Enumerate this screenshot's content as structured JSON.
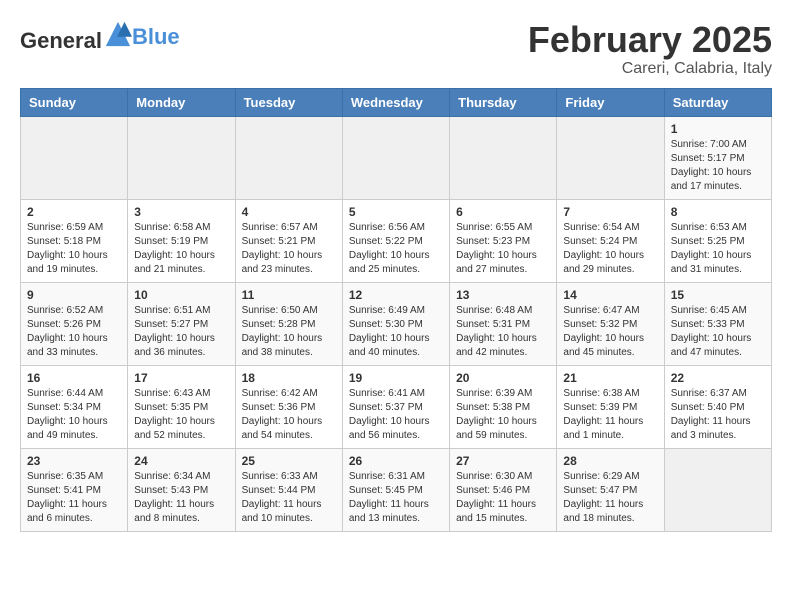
{
  "header": {
    "logo_general": "General",
    "logo_blue": "Blue",
    "title": "February 2025",
    "subtitle": "Careri, Calabria, Italy"
  },
  "days_of_week": [
    "Sunday",
    "Monday",
    "Tuesday",
    "Wednesday",
    "Thursday",
    "Friday",
    "Saturday"
  ],
  "weeks": [
    [
      {
        "day": "",
        "info": ""
      },
      {
        "day": "",
        "info": ""
      },
      {
        "day": "",
        "info": ""
      },
      {
        "day": "",
        "info": ""
      },
      {
        "day": "",
        "info": ""
      },
      {
        "day": "",
        "info": ""
      },
      {
        "day": "1",
        "info": "Sunrise: 7:00 AM\nSunset: 5:17 PM\nDaylight: 10 hours and 17 minutes."
      }
    ],
    [
      {
        "day": "2",
        "info": "Sunrise: 6:59 AM\nSunset: 5:18 PM\nDaylight: 10 hours and 19 minutes."
      },
      {
        "day": "3",
        "info": "Sunrise: 6:58 AM\nSunset: 5:19 PM\nDaylight: 10 hours and 21 minutes."
      },
      {
        "day": "4",
        "info": "Sunrise: 6:57 AM\nSunset: 5:21 PM\nDaylight: 10 hours and 23 minutes."
      },
      {
        "day": "5",
        "info": "Sunrise: 6:56 AM\nSunset: 5:22 PM\nDaylight: 10 hours and 25 minutes."
      },
      {
        "day": "6",
        "info": "Sunrise: 6:55 AM\nSunset: 5:23 PM\nDaylight: 10 hours and 27 minutes."
      },
      {
        "day": "7",
        "info": "Sunrise: 6:54 AM\nSunset: 5:24 PM\nDaylight: 10 hours and 29 minutes."
      },
      {
        "day": "8",
        "info": "Sunrise: 6:53 AM\nSunset: 5:25 PM\nDaylight: 10 hours and 31 minutes."
      }
    ],
    [
      {
        "day": "9",
        "info": "Sunrise: 6:52 AM\nSunset: 5:26 PM\nDaylight: 10 hours and 33 minutes."
      },
      {
        "day": "10",
        "info": "Sunrise: 6:51 AM\nSunset: 5:27 PM\nDaylight: 10 hours and 36 minutes."
      },
      {
        "day": "11",
        "info": "Sunrise: 6:50 AM\nSunset: 5:28 PM\nDaylight: 10 hours and 38 minutes."
      },
      {
        "day": "12",
        "info": "Sunrise: 6:49 AM\nSunset: 5:30 PM\nDaylight: 10 hours and 40 minutes."
      },
      {
        "day": "13",
        "info": "Sunrise: 6:48 AM\nSunset: 5:31 PM\nDaylight: 10 hours and 42 minutes."
      },
      {
        "day": "14",
        "info": "Sunrise: 6:47 AM\nSunset: 5:32 PM\nDaylight: 10 hours and 45 minutes."
      },
      {
        "day": "15",
        "info": "Sunrise: 6:45 AM\nSunset: 5:33 PM\nDaylight: 10 hours and 47 minutes."
      }
    ],
    [
      {
        "day": "16",
        "info": "Sunrise: 6:44 AM\nSunset: 5:34 PM\nDaylight: 10 hours and 49 minutes."
      },
      {
        "day": "17",
        "info": "Sunrise: 6:43 AM\nSunset: 5:35 PM\nDaylight: 10 hours and 52 minutes."
      },
      {
        "day": "18",
        "info": "Sunrise: 6:42 AM\nSunset: 5:36 PM\nDaylight: 10 hours and 54 minutes."
      },
      {
        "day": "19",
        "info": "Sunrise: 6:41 AM\nSunset: 5:37 PM\nDaylight: 10 hours and 56 minutes."
      },
      {
        "day": "20",
        "info": "Sunrise: 6:39 AM\nSunset: 5:38 PM\nDaylight: 10 hours and 59 minutes."
      },
      {
        "day": "21",
        "info": "Sunrise: 6:38 AM\nSunset: 5:39 PM\nDaylight: 11 hours and 1 minute."
      },
      {
        "day": "22",
        "info": "Sunrise: 6:37 AM\nSunset: 5:40 PM\nDaylight: 11 hours and 3 minutes."
      }
    ],
    [
      {
        "day": "23",
        "info": "Sunrise: 6:35 AM\nSunset: 5:41 PM\nDaylight: 11 hours and 6 minutes."
      },
      {
        "day": "24",
        "info": "Sunrise: 6:34 AM\nSunset: 5:43 PM\nDaylight: 11 hours and 8 minutes."
      },
      {
        "day": "25",
        "info": "Sunrise: 6:33 AM\nSunset: 5:44 PM\nDaylight: 11 hours and 10 minutes."
      },
      {
        "day": "26",
        "info": "Sunrise: 6:31 AM\nSunset: 5:45 PM\nDaylight: 11 hours and 13 minutes."
      },
      {
        "day": "27",
        "info": "Sunrise: 6:30 AM\nSunset: 5:46 PM\nDaylight: 11 hours and 15 minutes."
      },
      {
        "day": "28",
        "info": "Sunrise: 6:29 AM\nSunset: 5:47 PM\nDaylight: 11 hours and 18 minutes."
      },
      {
        "day": "",
        "info": ""
      }
    ]
  ]
}
